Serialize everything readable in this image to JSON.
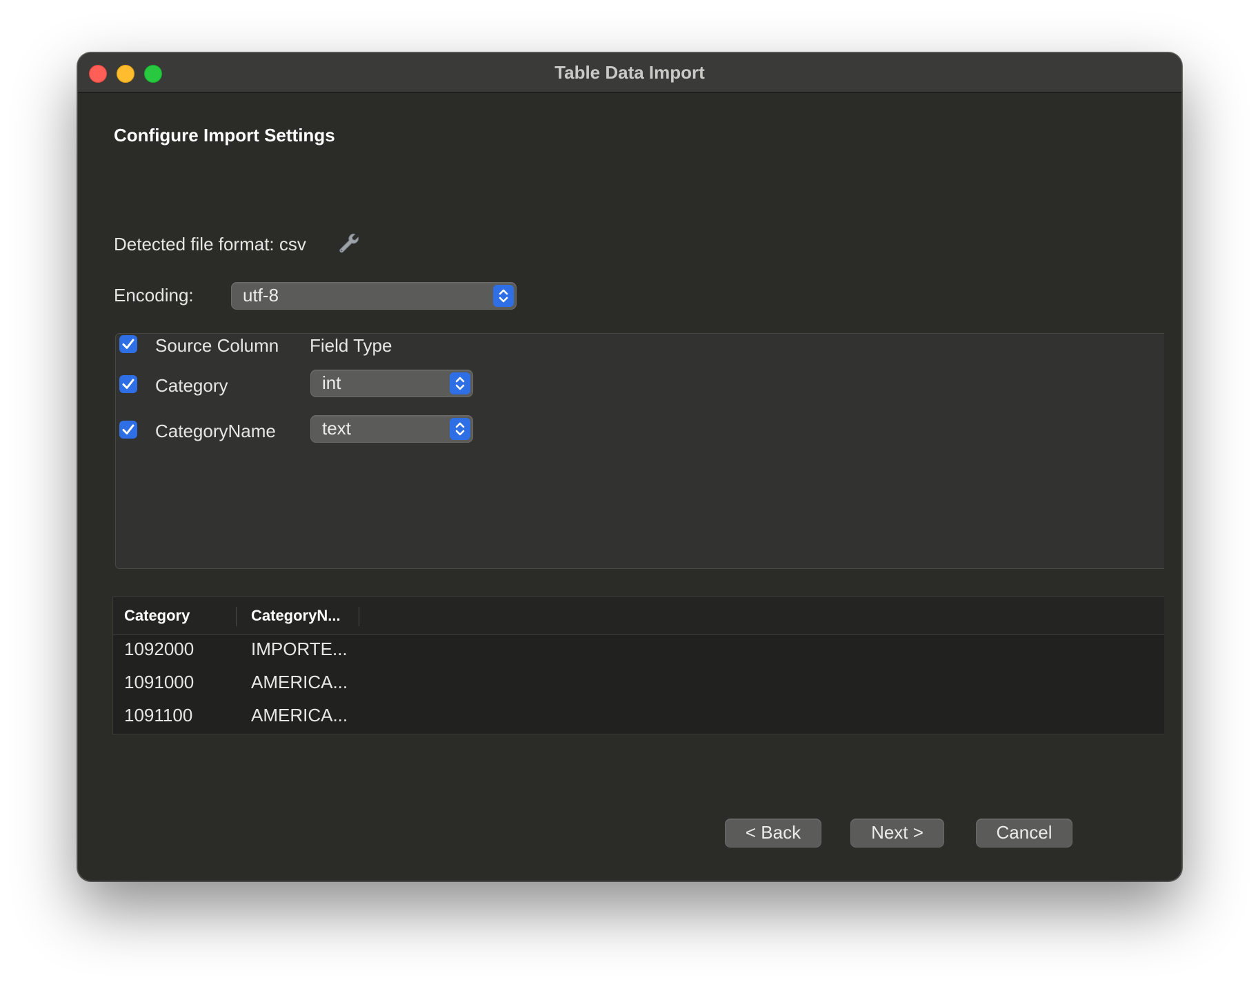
{
  "window": {
    "title": "Table Data Import"
  },
  "page": {
    "heading": "Configure Import Settings",
    "format_label": "Detected file format: csv",
    "encoding_label": "Encoding:",
    "encoding_value": "utf-8"
  },
  "mapping": {
    "header": {
      "checked": true,
      "source_column": "Source Column",
      "field_type": "Field Type"
    },
    "rows": [
      {
        "checked": true,
        "name": "Category",
        "type": "int"
      },
      {
        "checked": true,
        "name": "CategoryName",
        "type": "text"
      }
    ]
  },
  "preview": {
    "columns": [
      "Category",
      "CategoryN..."
    ],
    "rows": [
      [
        "1092000",
        "IMPORTE..."
      ],
      [
        "1091000",
        "AMERICA..."
      ],
      [
        "1091100",
        "AMERICA..."
      ]
    ]
  },
  "buttons": {
    "back": "< Back",
    "next": "Next >",
    "cancel": "Cancel"
  },
  "icons": {
    "close": "close-traffic-light",
    "minimize": "minimize-traffic-light",
    "maximize": "maximize-traffic-light",
    "format_settings": "wrench-icon",
    "checkbox": "checkmark-icon",
    "stepper": "up-down-chevron-icon"
  },
  "colors": {
    "accent": "#2f6fe6",
    "window_bg": "#2b2b28",
    "close": "#ff5f57",
    "minimize": "#febc2e",
    "maximize": "#28c840"
  }
}
